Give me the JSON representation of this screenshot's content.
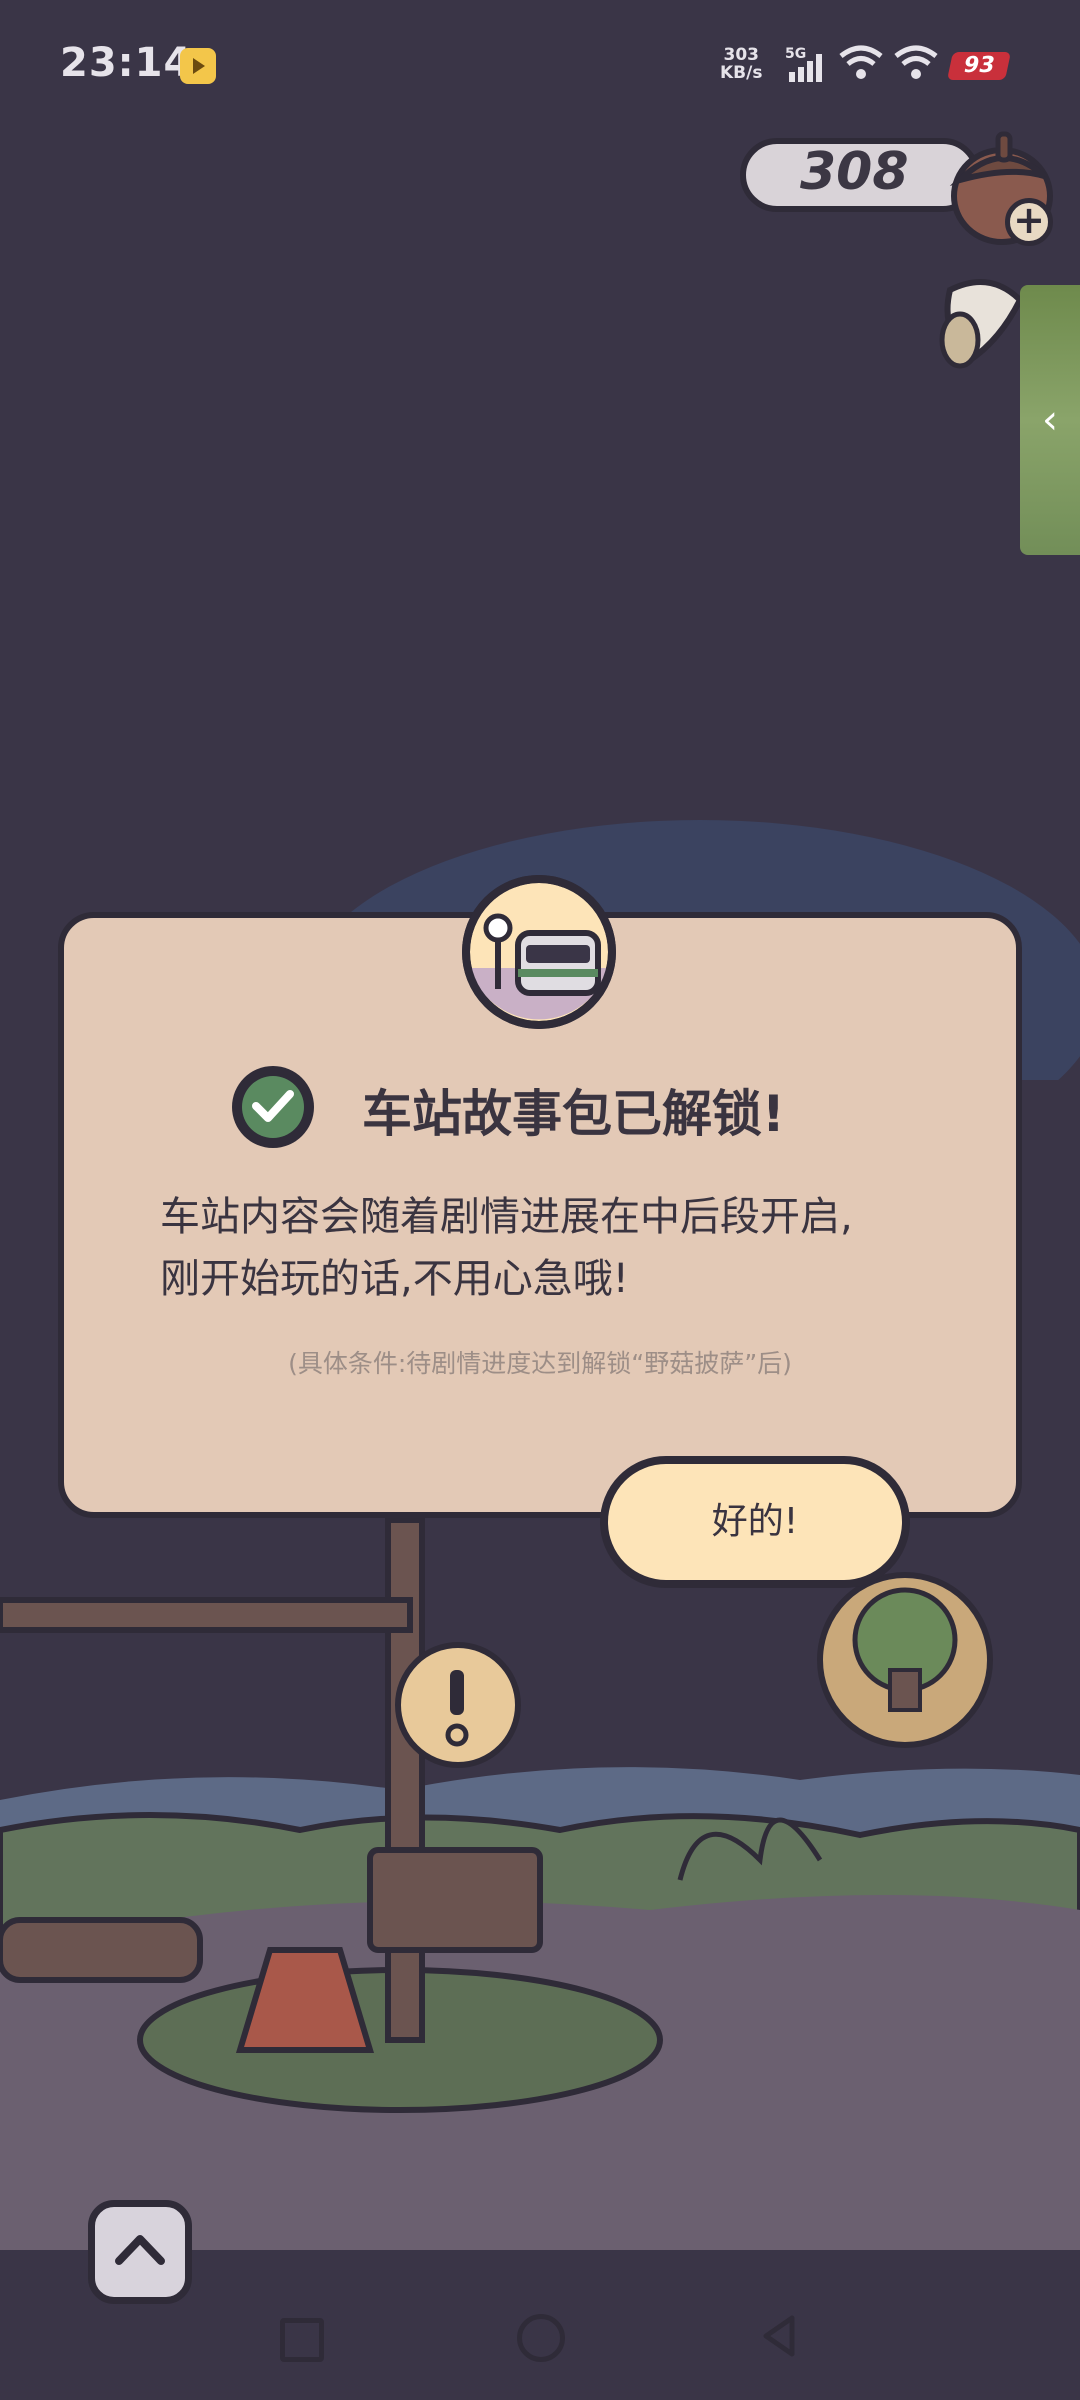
{
  "status_bar": {
    "time": "23:14",
    "net_speed_value": "303",
    "net_speed_unit": "KB/s",
    "network_type": "5G",
    "battery": "93"
  },
  "currency": {
    "value": "308",
    "icon": "acorn-icon"
  },
  "dialog": {
    "icon": "train-station-icon",
    "title": "车站故事包已解锁!",
    "body_line1": "车站内容会随着剧情进展在中后段开启,",
    "body_line2": "刚开始玩的话,不用心急哦!",
    "note": "(具体条件:待剧情进度达到解锁“野菇披萨”后)",
    "ok_label": "好的!"
  },
  "colors": {
    "background": "#3a3547",
    "dialog_bg": "#e3c9b6",
    "button_bg": "#fde4b8",
    "outline": "#2f2b38"
  }
}
